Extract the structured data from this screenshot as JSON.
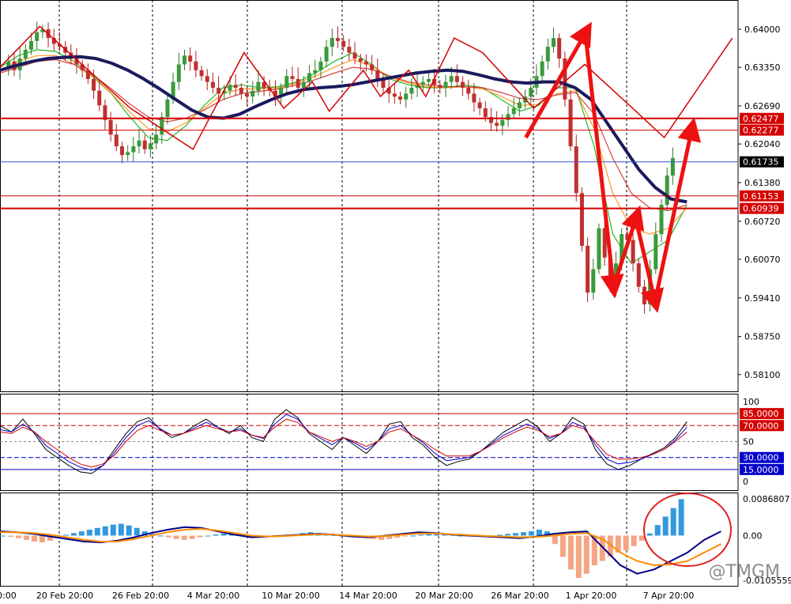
{
  "chart_data": [
    {
      "panel": "price",
      "type": "candlestick",
      "ylim": [
        0.578,
        0.645
      ],
      "y_ticks": [
        "0.64000",
        "0.63350",
        "0.62690",
        "0.62040",
        "0.61380",
        "0.60720",
        "0.60070",
        "0.59410",
        "0.58750",
        "0.58100"
      ],
      "x_ticks": [
        "20 Feb 20:00",
        "26 Feb 20:00",
        "4 Mar 20:00",
        "10 Mar 20:00",
        "14 Mar 20:00",
        "20 Mar 20:00",
        "26 Mar 20:00",
        "1 Apr 20:00",
        "7 Apr 20:00"
      ],
      "x_tick_partial_left": "0:00",
      "x_range": [
        0,
        130
      ],
      "close_series": [
        0.6335,
        0.6345,
        0.633,
        0.635,
        0.6365,
        0.638,
        0.6395,
        0.64,
        0.6385,
        0.6375,
        0.637,
        0.636,
        0.635,
        0.634,
        0.633,
        0.6315,
        0.6295,
        0.627,
        0.6245,
        0.622,
        0.62,
        0.6185,
        0.619,
        0.62,
        0.621,
        0.6195,
        0.6205,
        0.622,
        0.625,
        0.628,
        0.631,
        0.634,
        0.6355,
        0.6345,
        0.633,
        0.632,
        0.631,
        0.63,
        0.629,
        0.6295,
        0.6305,
        0.63,
        0.629,
        0.6285,
        0.6295,
        0.631,
        0.63,
        0.6295,
        0.6285,
        0.63,
        0.632,
        0.6315,
        0.63,
        0.631,
        0.6325,
        0.633,
        0.6345,
        0.637,
        0.6385,
        0.638,
        0.637,
        0.636,
        0.635,
        0.6345,
        0.634,
        0.633,
        0.6315,
        0.63,
        0.629,
        0.6285,
        0.628,
        0.629,
        0.63,
        0.6305,
        0.631,
        0.6315,
        0.6305,
        0.63,
        0.631,
        0.632,
        0.631,
        0.63,
        0.629,
        0.6275,
        0.6265,
        0.625,
        0.624,
        0.6235,
        0.6245,
        0.6255,
        0.6265,
        0.6275,
        0.6285,
        0.63,
        0.632,
        0.6345,
        0.637,
        0.6385,
        0.635,
        0.628,
        0.62,
        0.612,
        0.603,
        0.595,
        0.599,
        0.606,
        0.601,
        0.596,
        0.6,
        0.605,
        0.604,
        0.6,
        0.596,
        0.593,
        0.599,
        0.605,
        0.61,
        0.615,
        0.618
      ],
      "ema_series": [
        {
          "name": "",
          "color": "#1a1a5e",
          "values": [
            0.633,
            0.6338,
            0.6345,
            0.635,
            0.6352,
            0.6353,
            0.635,
            0.6342,
            0.633,
            0.6315,
            0.6298,
            0.628,
            0.6262,
            0.625,
            0.6248,
            0.6255,
            0.6268,
            0.628,
            0.629,
            0.6297,
            0.63,
            0.6302,
            0.6305,
            0.631,
            0.6315,
            0.632,
            0.6325,
            0.6328,
            0.633,
            0.6328,
            0.6322,
            0.6315,
            0.631,
            0.6308,
            0.631,
            0.631,
            0.63,
            0.628,
            0.624,
            0.62,
            0.616,
            0.613,
            0.611,
            0.6105
          ]
        },
        {
          "name": "",
          "color": "#00aa00",
          "values": [
            0.6335,
            0.6355,
            0.6365,
            0.6362,
            0.6345,
            0.632,
            0.629,
            0.625,
            0.6215,
            0.621,
            0.6235,
            0.627,
            0.63,
            0.6305,
            0.63,
            0.6302,
            0.631,
            0.6325,
            0.6345,
            0.636,
            0.634,
            0.6315,
            0.6305,
            0.63,
            0.63,
            0.6305,
            0.63,
            0.628,
            0.626,
            0.627,
            0.63,
            0.63,
            0.62,
            0.605,
            0.6,
            0.602,
            0.604,
            0.61
          ]
        },
        {
          "name": "",
          "color": "#ff8800",
          "values": [
            0.633,
            0.6345,
            0.6355,
            0.6355,
            0.634,
            0.6318,
            0.629,
            0.6258,
            0.623,
            0.6225,
            0.624,
            0.6265,
            0.629,
            0.6298,
            0.6298,
            0.63,
            0.6308,
            0.632,
            0.6335,
            0.6348,
            0.6338,
            0.6318,
            0.6308,
            0.6302,
            0.63,
            0.6302,
            0.6298,
            0.6285,
            0.627,
            0.6272,
            0.629,
            0.6295,
            0.623,
            0.612,
            0.606,
            0.605,
            0.606,
            0.6095
          ]
        },
        {
          "name": "",
          "color": "#cc2222",
          "values": [
            0.6325,
            0.6335,
            0.6345,
            0.6348,
            0.634,
            0.6322,
            0.6298,
            0.6272,
            0.625,
            0.6242,
            0.6248,
            0.6262,
            0.628,
            0.629,
            0.6294,
            0.6298,
            0.6305,
            0.6314,
            0.6325,
            0.6335,
            0.6332,
            0.632,
            0.631,
            0.6305,
            0.6302,
            0.6302,
            0.63,
            0.6292,
            0.6282,
            0.628,
            0.6288,
            0.6292,
            0.6255,
            0.618,
            0.612,
            0.6095,
            0.609,
            0.61
          ]
        }
      ],
      "horizontal_levels": [
        {
          "value": "0.62477",
          "color": "#d40000"
        },
        {
          "value": "0.62277",
          "color": "#d40000"
        },
        {
          "value": "0.61153",
          "color": "#d40000"
        },
        {
          "value": "0.60939",
          "color": "#d40000"
        }
      ],
      "current_price": {
        "value": "0.61735",
        "color": "#000000",
        "line_color": "#3355cc"
      },
      "zigzag": [
        [
          0.6335,
          0
        ],
        [
          0.6405,
          7
        ],
        [
          0.6265,
          23
        ],
        [
          0.6195,
          34
        ],
        [
          0.636,
          43
        ],
        [
          0.6265,
          50
        ],
        [
          0.631,
          55
        ],
        [
          0.626,
          58
        ],
        [
          0.633,
          64
        ],
        [
          0.6285,
          67
        ],
        [
          0.633,
          72
        ],
        [
          0.6285,
          75
        ],
        [
          0.6385,
          80
        ],
        [
          0.636,
          85
        ],
        [
          0.6265,
          94
        ],
        [
          0.634,
          103
        ],
        [
          0.626,
          112
        ],
        [
          0.6215,
          117
        ],
        [
          0.6385,
          129
        ]
      ],
      "annotation_arrows": [
        {
          "from": [
            114,
            0.6215
          ],
          "to": [
            127,
            0.6395
          ]
        },
        {
          "from": [
            127,
            0.6385
          ],
          "to": [
            133,
            0.596
          ]
        },
        {
          "from": [
            133,
            0.596
          ],
          "to": [
            138,
            0.608
          ]
        },
        {
          "from": [
            138,
            0.607
          ],
          "to": [
            142,
            0.5935
          ]
        },
        {
          "from": [
            142,
            0.5935
          ],
          "to": [
            150,
            0.623
          ]
        }
      ]
    },
    {
      "panel": "oscillator",
      "type": "line",
      "ylim": [
        0,
        100
      ],
      "y_ticks": [
        "100",
        "50",
        "0"
      ],
      "levels": [
        {
          "value": "85.0000",
          "color": "#d40000"
        },
        {
          "value": "70.0000",
          "color": "#d40000"
        },
        {
          "value": "30.0000",
          "color": "#0000cc"
        },
        {
          "value": "15.0000",
          "color": "#0000cc"
        }
      ],
      "series": [
        {
          "name": "",
          "color": "#000000",
          "values": [
            70,
            62,
            78,
            60,
            40,
            30,
            20,
            12,
            10,
            20,
            40,
            60,
            75,
            80,
            65,
            55,
            60,
            70,
            78,
            68,
            60,
            70,
            55,
            50,
            78,
            90,
            80,
            60,
            50,
            40,
            55,
            45,
            35,
            50,
            72,
            75,
            55,
            45,
            30,
            20,
            25,
            28,
            38,
            50,
            62,
            70,
            78,
            68,
            50,
            60,
            80,
            72,
            40,
            22,
            15,
            20,
            28,
            35,
            42,
            55,
            75
          ]
        },
        {
          "name": "",
          "color": "#0000cc",
          "values": [
            65,
            62,
            72,
            62,
            45,
            35,
            25,
            18,
            14,
            20,
            36,
            55,
            70,
            76,
            66,
            58,
            60,
            67,
            74,
            68,
            62,
            66,
            58,
            54,
            72,
            84,
            78,
            62,
            54,
            46,
            55,
            48,
            40,
            50,
            66,
            70,
            58,
            48,
            35,
            26,
            28,
            30,
            38,
            48,
            58,
            65,
            72,
            66,
            54,
            60,
            74,
            68,
            46,
            28,
            22,
            24,
            28,
            34,
            40,
            52,
            68
          ]
        },
        {
          "name": "",
          "color": "#d40000",
          "values": [
            62,
            60,
            68,
            62,
            50,
            40,
            30,
            22,
            18,
            22,
            33,
            50,
            64,
            70,
            64,
            58,
            60,
            65,
            70,
            66,
            62,
            64,
            58,
            55,
            68,
            78,
            74,
            62,
            56,
            50,
            55,
            50,
            44,
            50,
            62,
            66,
            58,
            50,
            40,
            32,
            32,
            32,
            38,
            46,
            55,
            62,
            68,
            64,
            56,
            60,
            70,
            66,
            50,
            34,
            28,
            28,
            30,
            34,
            40,
            50,
            62
          ]
        }
      ]
    },
    {
      "panel": "macd",
      "type": "bar",
      "ylim": [
        -0.0105559,
        0.0086807
      ],
      "y_ticks": [
        "0.0086807",
        "0.00",
        "-0.0105559"
      ],
      "histogram": [
        0.0,
        -0.0003,
        -0.0006,
        -0.001,
        -0.0014,
        -0.0016,
        -0.0012,
        -0.0006,
        0.0002,
        0.0006,
        0.001,
        0.0014,
        0.0018,
        0.0022,
        0.0026,
        0.0028,
        0.0024,
        0.0018,
        0.001,
        0.0004,
        0.0,
        -0.0004,
        -0.0008,
        -0.001,
        -0.0008,
        -0.0004,
        0.0,
        0.0003,
        0.0005,
        0.0006,
        0.0004,
        0.0002,
        0.0,
        -0.0002,
        -0.0003,
        -0.0002,
        0.0,
        0.0003,
        0.0006,
        0.0008,
        0.0006,
        0.0003,
        0.0001,
        0.0,
        -0.0002,
        -0.0004,
        -0.0006,
        -0.0008,
        -0.001,
        -0.0008,
        -0.0005,
        -0.0002,
        0.0,
        0.0002,
        0.0004,
        0.0006,
        0.0004,
        0.0002,
        0.0,
        -0.0002,
        -0.0003,
        -0.0002,
        0.0,
        0.0002,
        0.0004,
        0.0006,
        0.0008,
        0.001,
        0.0014,
        0.001,
        -0.002,
        -0.005,
        -0.008,
        -0.01,
        -0.009,
        -0.007,
        -0.006,
        -0.005,
        -0.004,
        -0.0035,
        -0.0025,
        -0.0012,
        0.0005,
        0.0025,
        0.0045,
        0.0065,
        0.0086
      ],
      "series": [
        {
          "name": "",
          "color": "#00008b",
          "values": [
            0.001,
            0.0008,
            0.0004,
            -0.0002,
            -0.0008,
            -0.0014,
            -0.0016,
            -0.0012,
            -0.0004,
            0.0006,
            0.0014,
            0.002,
            0.0018,
            0.001,
            0.0002,
            -0.0004,
            -0.0002,
            0.0,
            0.0002,
            0.0004,
            0.0002,
            -0.0002,
            -0.0004,
            0.0,
            0.0004,
            0.0008,
            0.0006,
            0.0002,
            0.0,
            -0.0002,
            -0.0004,
            -0.0006,
            -0.0002,
            0.0004,
            0.0008,
            0.001,
            -0.003,
            -0.007,
            -0.009,
            -0.008,
            -0.006,
            -0.004,
            -0.001,
            0.001
          ]
        },
        {
          "name": "",
          "color": "#ff8c00",
          "values": [
            0.0008,
            0.0008,
            0.0006,
            0.0002,
            -0.0004,
            -0.001,
            -0.0014,
            -0.0014,
            -0.0008,
            0.0,
            0.0008,
            0.0014,
            0.0016,
            0.0012,
            0.0006,
            0.0,
            -0.0002,
            -0.0001,
            0.0001,
            0.0003,
            0.0002,
            0.0,
            -0.0002,
            -0.0001,
            0.0002,
            0.0005,
            0.0005,
            0.0003,
            0.0001,
            -0.0001,
            -0.0002,
            -0.0004,
            -0.0003,
            0.0,
            0.0004,
            0.0006,
            -0.001,
            -0.004,
            -0.006,
            -0.007,
            -0.0068,
            -0.006,
            -0.004,
            -0.002
          ]
        }
      ],
      "histogram_colors": {
        "positive": "#3399dd",
        "negative": "#f4a582"
      },
      "highlight": {
        "shape": "ellipse",
        "color": "#e02020",
        "region": "latest bars"
      }
    }
  ],
  "colors": {
    "grid": "#000000",
    "background": "#ffffff",
    "accent_red": "#e02020"
  },
  "watermark": "@TMGM"
}
